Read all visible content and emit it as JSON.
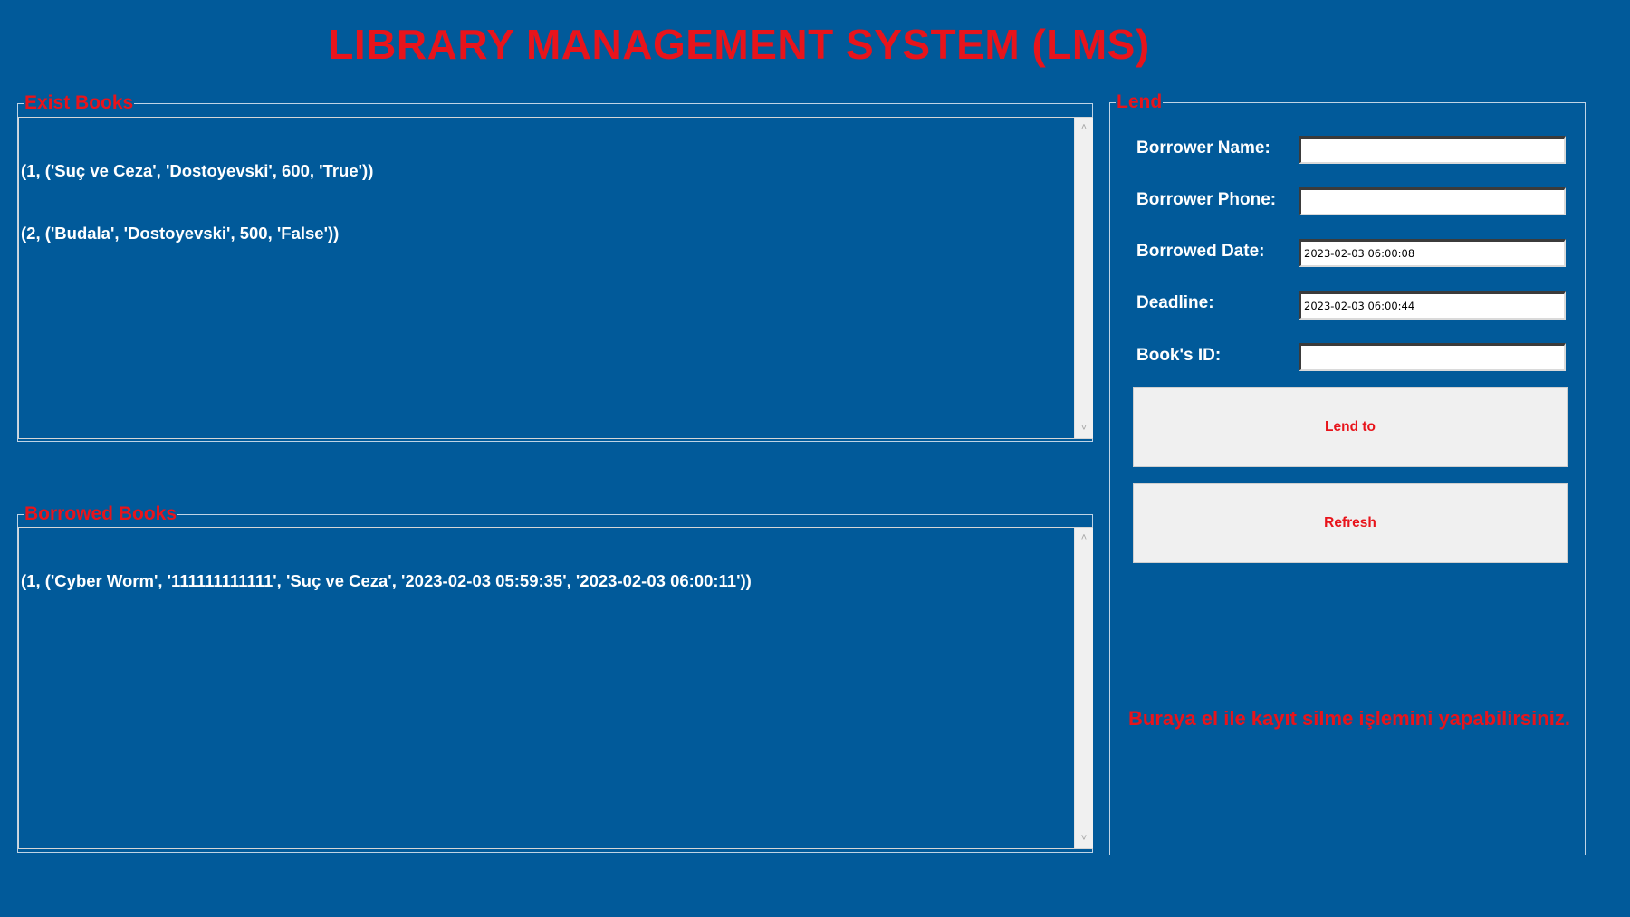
{
  "app": {
    "title": "LIBRARY MANAGEMENT SYSTEM (LMS)"
  },
  "colors": {
    "background": "#015A9A",
    "accent_red": "#E8141B",
    "list_text": "#FFFFFF",
    "button_face": "#F0F0F0"
  },
  "exist_books": {
    "legend": "Exist Books",
    "rows": [
      "(1, ('Suç ve Ceza', 'Dostoyevski', 600, 'True'))",
      "(2, ('Budala', 'Dostoyevski', 500, 'False'))"
    ]
  },
  "borrowed_books": {
    "legend": "Borrowed Books",
    "rows": [
      "(1, ('Cyber Worm', '111111111111', 'Suç ve Ceza', '2023-02-03 05:59:35', '2023-02-03 06:00:11'))"
    ]
  },
  "lend": {
    "legend": "Lend",
    "fields": {
      "borrower_name": {
        "label": "Borrower Name:",
        "value": ""
      },
      "borrower_phone": {
        "label": "Borrower Phone:",
        "value": ""
      },
      "borrowed_date": {
        "label": "Borrowed Date:",
        "value": "2023-02-03 06:00:08"
      },
      "deadline": {
        "label": "Deadline:",
        "value": "2023-02-03 06:00:44"
      },
      "book_id": {
        "label": "Book's ID:",
        "value": ""
      }
    },
    "lend_button_label": "Lend to",
    "refresh_button_label": "Refresh",
    "hint": "Buraya el ile kayıt silme işlemini yapabilirsiniz."
  },
  "scrollbar": {
    "up_icon": "chevron-up-icon",
    "down_icon": "chevron-down-icon"
  }
}
